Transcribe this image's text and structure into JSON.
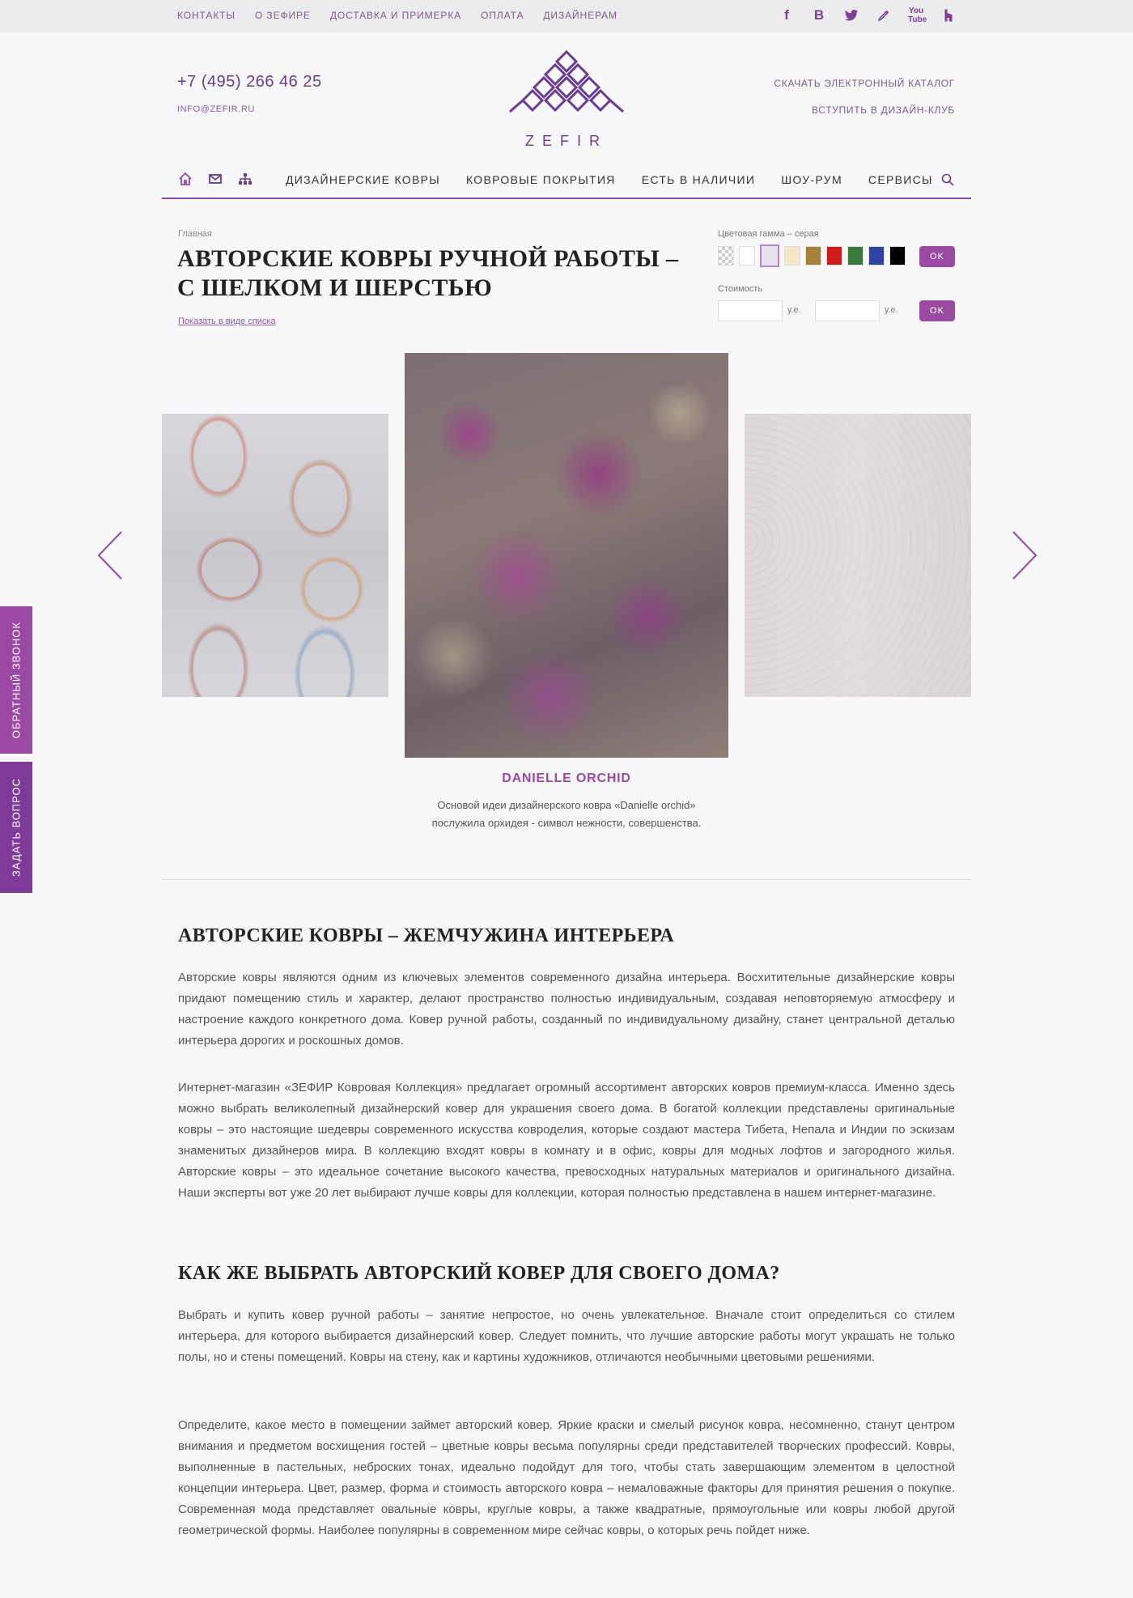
{
  "topnav": [
    "КОНТАКТЫ",
    "О ЗЕФИРЕ",
    "ДОСТАВКА И ПРИМЕРКА",
    "ОПЛАТА",
    "ДИЗАЙНЕРАМ"
  ],
  "social": [
    "facebook-icon",
    "vkontakte-icon",
    "twitter-icon",
    "pen-icon",
    "youtube-icon",
    "houzz-icon"
  ],
  "header": {
    "phone": "+7 (495) 266 46 25",
    "email": "INFO@ZEFIR.RU",
    "logo_text": "ZEFIR",
    "catalog_link": "СКАЧАТЬ ЭЛЕКТРОННЫЙ КАТАЛОГ",
    "club_link": "ВСТУПИТЬ В ДИЗАЙН-КЛУБ"
  },
  "mainnav": [
    "ДИЗАЙНЕРСКИЕ КОВРЫ",
    "КОВРОВЫЕ ПОКРЫТИЯ",
    "ЕСТЬ В НАЛИЧИИ",
    "ШОУ-РУМ",
    "СЕРВИСЫ"
  ],
  "breadcrumb": "Главная",
  "title": "АВТОРСКИЕ КОВРЫ РУЧНОЙ РАБОТЫ – С ШЕЛКОМ И ШЕРСТЬЮ",
  "list_view": "Показать в виде списка",
  "filters": {
    "color_label": "Цветовая гамма – серая",
    "colors": [
      "transparent",
      "#ffffff",
      "#e6e0ea",
      "#f5e8c8",
      "#a9823a",
      "#d11a1a",
      "#3a7a3c",
      "#2e44a0",
      "#000000"
    ],
    "selected_color_index": 2,
    "ok": "OK",
    "price_label": "Стоимость",
    "unit": "у.е.",
    "price_from": "",
    "price_to": ""
  },
  "product": {
    "name": "DANIELLE ORCHID",
    "description": "Основой идеи дизайнерского ковра «Danielle orchid» послужила орхидея - символ нежности, совершенства."
  },
  "sidetabs": {
    "callback": "ОБРАТНЫЙ ЗВОНОК",
    "question": "ЗАДАТЬ ВОПРОС"
  },
  "article": {
    "h1": "АВТОРСКИЕ КОВРЫ – ЖЕМЧУЖИНА ИНТЕРЬЕРА",
    "p1": "Авторские ковры являются одним из ключевых элементов современного дизайна интерьера. Восхитительные дизайнерские ковры придают помещению стиль и характер, делают пространство полностью индивидуальным, создавая неповторяемую атмосферу и настроение каждого конкретного дома. Ковер ручной работы, созданный по индивидуальному дизайну, станет центральной деталью интерьера дорогих и роскошных домов.",
    "p2": "Интернет-магазин «ЗЕФИР Ковровая Коллекция» предлагает огромный ассортимент авторских ковров премиум-класса. Именно здесь можно выбрать великолепный дизайнерский ковер для украшения своего дома. В богатой коллекции представлены оригинальные ковры – это настоящие шедевры современного искусства ковроделия, которые создают мастера Тибета, Непала и Индии по эскизам знаменитых дизайнеров мира. В коллекцию входят ковры в комнату и в офис, ковры для модных лофтов и загородного жилья. Авторские ковры – это идеальное сочетание высокого качества, превосходных натуральных материалов и оригинального дизайна. Наши эксперты вот уже 20 лет выбирают лучше ковры для коллекции, которая полностью представлена в нашем интернет-магазине.",
    "h2": "КАК ЖЕ ВЫБРАТЬ АВТОРСКИЙ КОВЕР ДЛЯ СВОЕГО ДОМА?",
    "p3": "Выбрать и купить ковер ручной работы – занятие непростое, но очень увлекательное. Вначале стоит определиться со стилем интерьера, для которого выбирается дизайнерский ковер. Следует помнить, что лучшие авторские работы могут украшать не только полы, но и стены помещений. Ковры на стену, как и картины художников, отличаются необычными цветовыми решениями.",
    "p4": "Определите, какое место в помещении займет авторский ковер. Яркие краски и смелый рисунок ковра, несомненно, станут центром внимания и предметом восхищения гостей – цветные ковры весьма популярны среди представителей творческих профессий. Ковры, выполненные в пастельных, неброских тонах, идеально подойдут для того, чтобы стать завершающим элементом в целостной концепции интерьера. Цвет, размер, форма и стоимость авторского ковра – немаловажные факторы для принятия решения о покупке. Современная мода представляет овальные ковры, круглые ковры, а также квадратные, прямоугольные или ковры любой другой геометрической формы. Наиболее популярны в современном мире сейчас ковры, о которых речь пойдет ниже."
  }
}
